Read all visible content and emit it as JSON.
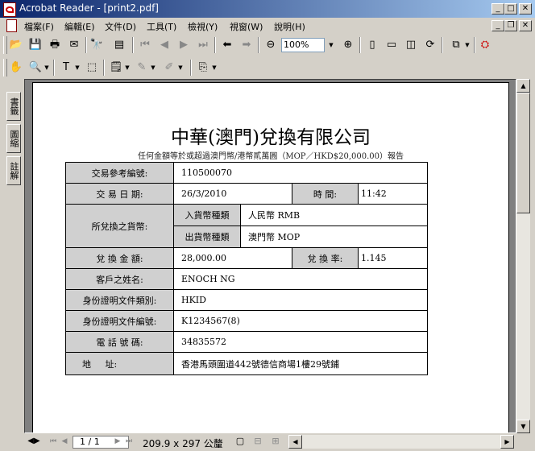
{
  "window": {
    "title": "Acrobat Reader - [print2.pdf]"
  },
  "menu": [
    "檔案(F)",
    "編輯(E)",
    "文件(D)",
    "工具(T)",
    "檢視(Y)",
    "視窗(W)",
    "說明(H)"
  ],
  "toolbar": {
    "zoom_value": "100%"
  },
  "left_tabs": [
    "書籤",
    "圖縮",
    "註解"
  ],
  "status": {
    "page_display": "1 / 1",
    "page_size": "209.9 x 297 公釐"
  },
  "document": {
    "title": "中華(澳門)兌換有限公司",
    "subtitle": "任何金額等於或超過澳門幣/港幣貳萬圓（MOP／HKD$20,000.00）報告",
    "rows": {
      "ref_label": "交易參考編號:",
      "ref_value": "110500070",
      "date_label": "交 易 日 期:",
      "date_value": "26/3/2010",
      "time_label": "時  間:",
      "time_value": "11:42",
      "currency_label": "所兌換之貨幣:",
      "in_label": "入貨幣種類",
      "in_value": "人民幣 RMB",
      "out_label": "出貨幣種類",
      "out_value": "澳門幣 MOP",
      "amount_label": "兌 換 金 額:",
      "amount_value": "28,000.00",
      "rate_label": "兌 換 率:",
      "rate_value": "1.145",
      "name_label": "客戶之姓名:",
      "name_value": "ENOCH NG",
      "idtype_label": "身份證明文件類別:",
      "idtype_value": "HKID",
      "idno_label": "身份證明文件編號:",
      "idno_value": "K1234567(8)",
      "phone_label": "電 話 號 碼:",
      "phone_value": "34835572",
      "addr_label": "地     址:",
      "addr_value": "香港馬頭圍道442號德信商場1樓29號鋪"
    }
  }
}
